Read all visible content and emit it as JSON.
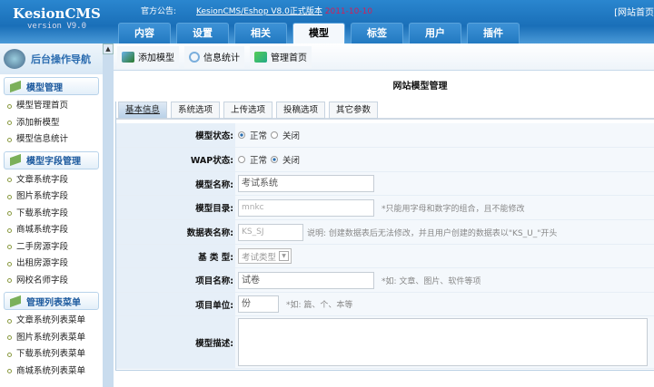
{
  "header": {
    "logo": "KesionCMS",
    "version": "version V9.0",
    "notice_label": "官方公告:",
    "notice_link": "KesionCMS/Eshop V8.0正式版本",
    "notice_date": "2011-10-10",
    "home_link": "[网站首页"
  },
  "tabs": [
    {
      "label": "内容"
    },
    {
      "label": "设置"
    },
    {
      "label": "相关"
    },
    {
      "label": "模型",
      "active": true
    },
    {
      "label": "标签"
    },
    {
      "label": "用户"
    },
    {
      "label": "插件"
    }
  ],
  "sidebar": {
    "title": "后台操作导航",
    "sections": [
      {
        "title": "模型管理",
        "items": [
          "模型管理首页",
          "添加新模型",
          "模型信息统计"
        ]
      },
      {
        "title": "模型字段管理",
        "items": [
          "文章系统字段",
          "图片系统字段",
          "下载系统字段",
          "商城系统字段",
          "二手房源字段",
          "出租房源字段",
          "网校名师字段"
        ]
      },
      {
        "title": "管理列表菜单",
        "items": [
          "文章系统列表菜单",
          "图片系统列表菜单",
          "下载系统列表菜单",
          "商城系统列表菜单"
        ]
      }
    ]
  },
  "toolbar": [
    {
      "label": "添加模型",
      "icon": "add-model-icon"
    },
    {
      "label": "信息统计",
      "icon": "gear-icon"
    },
    {
      "label": "管理首页",
      "icon": "refresh-icon"
    }
  ],
  "page_title": "网站模型管理",
  "form_tabs": [
    {
      "label": "基本信息",
      "active": true
    },
    {
      "label": "系统选项"
    },
    {
      "label": "上传选项"
    },
    {
      "label": "投稿选项"
    },
    {
      "label": "其它参数"
    }
  ],
  "form": {
    "model_status": {
      "label": "模型状态:",
      "options": [
        "正常",
        "关闭"
      ],
      "selected": "正常"
    },
    "wap_status": {
      "label": "WAP状态:",
      "options": [
        "正常",
        "关闭"
      ],
      "selected": "关闭"
    },
    "model_name": {
      "label": "模型名称:",
      "value": "考试系统"
    },
    "model_dir": {
      "label": "模型目录:",
      "value": "mnkc",
      "note": "*只能用字母和数字的组合，且不能修改"
    },
    "table_name": {
      "label": "数据表名称:",
      "value": "KS_SJ",
      "note": "说明: 创建数据表后无法修改，并且用户创建的数据表以\"KS_U_\"开头"
    },
    "base_type": {
      "label": "基 类 型:",
      "value": "考试类型"
    },
    "item_name": {
      "label": "项目名称:",
      "value": "试卷",
      "note": "*如: 文章、图片、软件等项"
    },
    "item_unit": {
      "label": "项目单位:",
      "value": "份",
      "note": "*如: 篇、个、本等"
    },
    "description": {
      "label": "模型描述:",
      "value": ""
    }
  },
  "colors": {
    "header": "#1a6fb8",
    "accent": "#2c6db0"
  }
}
